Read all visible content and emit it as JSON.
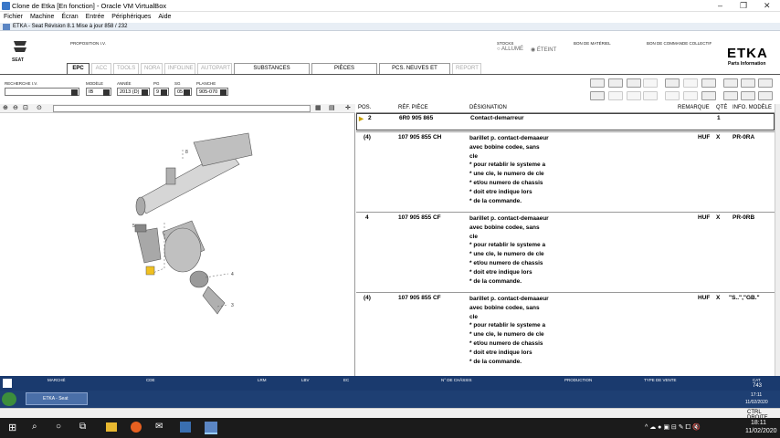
{
  "window": {
    "title": "Clone de Etka [En fonction] - Oracle VM VirtualBox"
  },
  "vbmenu": [
    "Fichier",
    "Machine",
    "Écran",
    "Entrée",
    "Périphériques",
    "Aide"
  ],
  "etka_titlebar": "ETKA - Seat Révision 8.1 Mise à jour 858 / 232",
  "header": {
    "brand": "SEAT",
    "proposition_label": "PROPOSITION I.V.",
    "stocks_label": "STOCKS",
    "stock_options": [
      "ALLUMÉ",
      "ÉTEINT"
    ],
    "bon_materiel": "BON DE MATÉRIEL",
    "bon_commande": "BON DE COMMANDE COLLECTIF",
    "logo": "ETKA",
    "logo_sub": "Parts Information",
    "tabs": [
      {
        "label": "EPC",
        "state": "active"
      },
      {
        "label": "ACC",
        "state": "disabled"
      },
      {
        "label": "TOOLS",
        "state": "disabled"
      },
      {
        "label": "NORA",
        "state": "disabled"
      },
      {
        "label": "INFOLINE",
        "state": "disabled"
      },
      {
        "label": "AUTOPART",
        "state": "disabled"
      },
      {
        "label": "SUBSTANCES CHIMIQUES",
        "state": "normal"
      },
      {
        "label": "PIÈCES NORMALISÉES",
        "state": "normal"
      },
      {
        "label": "PCS. NEUVES ET SUPPR.",
        "state": "normal"
      },
      {
        "label": "REPORT",
        "state": "disabled"
      }
    ]
  },
  "filters": {
    "recherche_label": "RECHERCHE I.V.",
    "modele_label": "MODÈLE",
    "modele": "IB",
    "annee_label": "ANNÉE",
    "annee": "2013 (D)",
    "pg_label": "PG",
    "pg": "9",
    "sg_label": "SG",
    "sg": "05",
    "planche_label": "PLANCHE",
    "planche": "905-070"
  },
  "table": {
    "headers": {
      "pos": "POS.",
      "ref": "RÉF. PIÈCE",
      "designation": "DÉSIGNATION",
      "remarque": "REMARQUE",
      "qte": "QTÉ",
      "info": "INFO. MODÈLE"
    },
    "rows": [
      {
        "pos": "2",
        "ref": "6R0 905 865",
        "designation": [
          "Contact-demarreur"
        ],
        "remarque": "",
        "qte": "1",
        "info": ""
      },
      {
        "pos": "(4)",
        "ref": "107 905 855 CH",
        "designation": [
          "barillet p. contact-demaaeur",
          "avec bobine codee, sans",
          "cle",
          "* pour retablir le systeme a",
          "* une cle, le numero de cle",
          "* et/ou numero de chassis",
          "* doit etre indique lors",
          "* de la commande."
        ],
        "remarque": "HUF",
        "qte": "X",
        "info": "PR-0RA"
      },
      {
        "pos": "4",
        "ref": "107 905 855 CF",
        "designation": [
          "barillet p. contact-demaaeur",
          "avec bobine codee, sans",
          "cle",
          "* pour retablir le systeme a",
          "* une cle, le numero de cle",
          "* et/ou numero de chassis",
          "* doit etre indique lors",
          "* de la commande."
        ],
        "remarque": "HUF",
        "qte": "X",
        "info": "PR-0RB"
      },
      {
        "pos": "(4)",
        "ref": "107 905 855 CF",
        "designation": [
          "barillet p. contact-demaaeur",
          "avec bobine codee, sans",
          "cle",
          "* pour retablir le systeme a",
          "* une cle, le numero de cle",
          "* et/ou numero de chassis",
          "* doit etre indique lors",
          "* de la commande."
        ],
        "remarque": "HUF",
        "qte": "X",
        "info": "\"S..\",\"GB.\""
      }
    ]
  },
  "diagram_labels": [
    "8",
    "5",
    "4",
    "3"
  ],
  "statusbar": {
    "marche": "MARCHÉ",
    "cde": "CDE",
    "lrm": "LRM",
    "lbv": "LBV",
    "ec": "EC",
    "chassis": "N° DE CHÂSSIS",
    "production": "PRODUCTION",
    "type_vente": "TYPE DE VENTE",
    "cat": "CAT",
    "cat_value": "743"
  },
  "inner_taskbar": {
    "app": "ETKA - Seat",
    "time": "17:11",
    "date": "11/02/2020"
  },
  "vbstatus": {
    "host_key": "CTRL DROITE"
  },
  "win_taskbar": {
    "time": "18:11",
    "date": "11/02/2020"
  }
}
